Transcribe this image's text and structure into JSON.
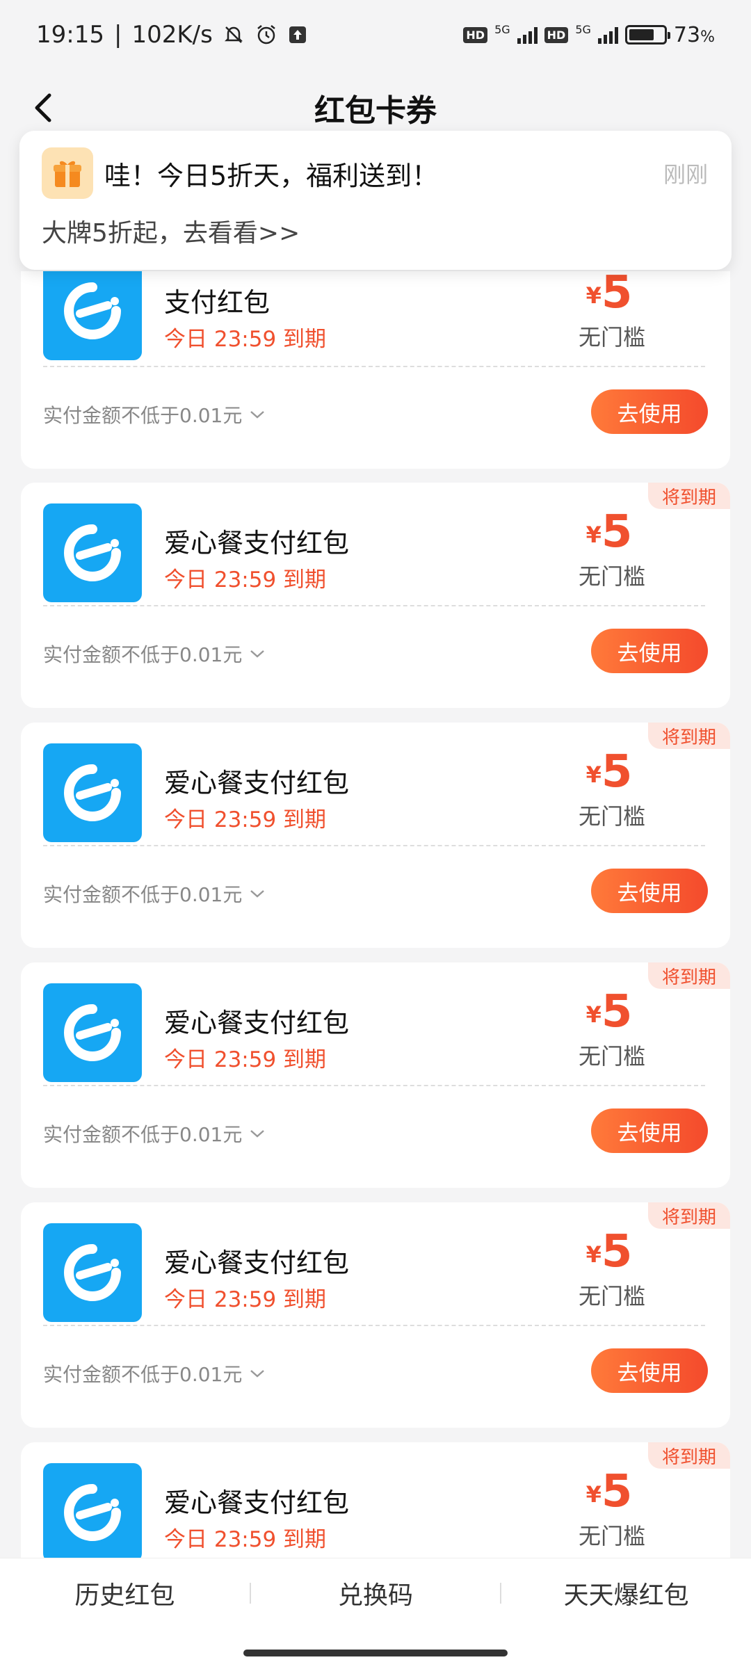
{
  "status_bar": {
    "time": "19:15",
    "speed": "102K/s",
    "battery": "73",
    "battery_unit": "%",
    "battery_fraction": 0.73,
    "network_a": "5G",
    "network_b": "5G",
    "hd_label": "HD"
  },
  "header": {
    "title": "红包卡券"
  },
  "notification": {
    "title": "哇！今日5折天，福利送到！",
    "time": "刚刚",
    "body": "大牌5折起，去看看>>"
  },
  "cards": [
    {
      "title": "支付红包",
      "expiry": "今日 23:59 到期",
      "currency": "¥",
      "amount": "5",
      "threshold": "无门槛",
      "condition": "实付金额不低于0.01元",
      "button": "去使用",
      "tag": ""
    },
    {
      "title": "爱心餐支付红包",
      "expiry": "今日 23:59 到期",
      "currency": "¥",
      "amount": "5",
      "threshold": "无门槛",
      "condition": "实付金额不低于0.01元",
      "button": "去使用",
      "tag": "将到期"
    },
    {
      "title": "爱心餐支付红包",
      "expiry": "今日 23:59 到期",
      "currency": "¥",
      "amount": "5",
      "threshold": "无门槛",
      "condition": "实付金额不低于0.01元",
      "button": "去使用",
      "tag": "将到期"
    },
    {
      "title": "爱心餐支付红包",
      "expiry": "今日 23:59 到期",
      "currency": "¥",
      "amount": "5",
      "threshold": "无门槛",
      "condition": "实付金额不低于0.01元",
      "button": "去使用",
      "tag": "将到期"
    },
    {
      "title": "爱心餐支付红包",
      "expiry": "今日 23:59 到期",
      "currency": "¥",
      "amount": "5",
      "threshold": "无门槛",
      "condition": "实付金额不低于0.01元",
      "button": "去使用",
      "tag": "将到期"
    },
    {
      "title": "爱心餐支付红包",
      "expiry": "今日 23:59 到期",
      "currency": "¥",
      "amount": "5",
      "threshold": "无门槛",
      "condition": "",
      "button": "",
      "tag": "将到期"
    }
  ],
  "tab_bar": {
    "tabs": [
      "历史红包",
      "兑换码",
      "天天爆红包"
    ]
  },
  "colors": {
    "accent_red": "#f0502e",
    "logo_blue": "#16a7f3",
    "tag_bg": "#fde6e0"
  },
  "icons": {
    "back": "chevron-left-icon",
    "gift": "gift-icon",
    "brand": "eleme-logo-icon",
    "expand": "chevron-down-icon"
  }
}
